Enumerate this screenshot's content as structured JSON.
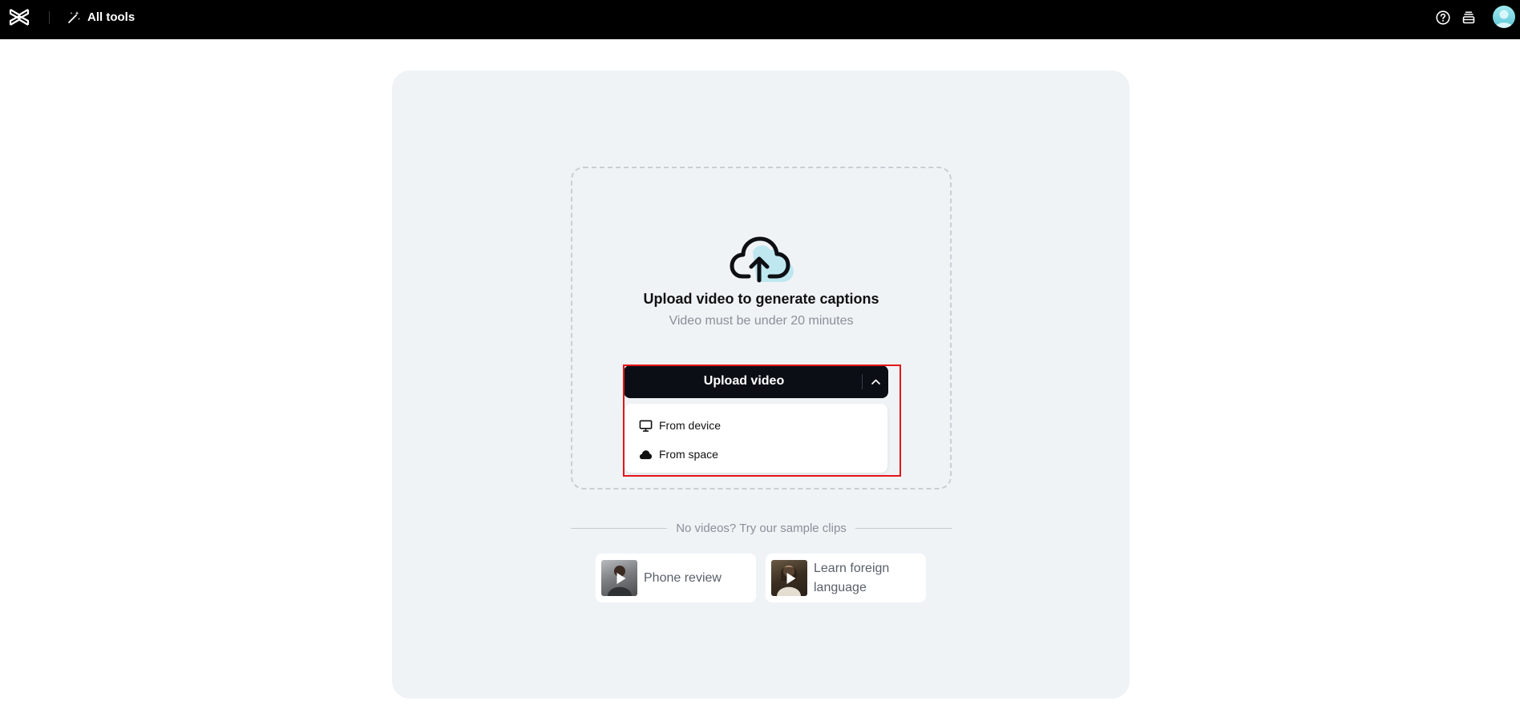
{
  "topbar": {
    "all_tools_label": "All tools",
    "icons": [
      "capcut-logo-icon",
      "magic-wand-icon",
      "help-icon",
      "layers-icon",
      "avatar"
    ]
  },
  "upload": {
    "title": "Upload video to generate captions",
    "subtitle": "Video must be under 20 minutes",
    "button_label": "Upload video",
    "menu": [
      {
        "label": "From device",
        "icon": "monitor-icon"
      },
      {
        "label": "From space",
        "icon": "cloud-icon"
      }
    ]
  },
  "samples": {
    "header": "No videos? Try our sample clips",
    "items": [
      {
        "label": "Phone review"
      },
      {
        "label": "Learn foreign language"
      }
    ]
  },
  "colors": {
    "topbar": "#000000",
    "card": "#f0f3f6",
    "button": "#0c0e15",
    "highlight": "#e3151a"
  }
}
